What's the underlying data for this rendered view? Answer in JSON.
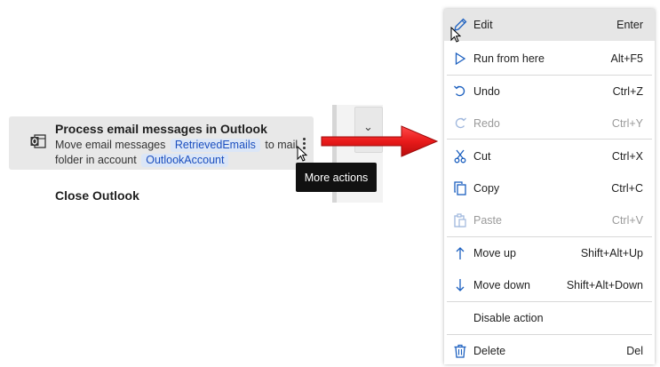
{
  "action_list": {
    "card": {
      "title": "Process email messages in Outlook",
      "desc_part1": "Move email messages",
      "token1": "RetrievedEmails",
      "desc_part2": "to mail folder  in account",
      "token2": "OutlookAccount"
    },
    "next_action_title": "Close Outlook",
    "more_actions_tooltip": "More actions"
  },
  "context_menu": {
    "items": [
      {
        "label": "Edit",
        "shortcut": "Enter",
        "icon": "pencil-icon"
      },
      {
        "label": "Run from here",
        "shortcut": "Alt+F5",
        "icon": "play-icon"
      },
      {
        "label": "Undo",
        "shortcut": "Ctrl+Z",
        "icon": "undo-icon"
      },
      {
        "label": "Redo",
        "shortcut": "Ctrl+Y",
        "icon": "redo-icon"
      },
      {
        "label": "Cut",
        "shortcut": "Ctrl+X",
        "icon": "scissors-icon"
      },
      {
        "label": "Copy",
        "shortcut": "Ctrl+C",
        "icon": "copy-icon"
      },
      {
        "label": "Paste",
        "shortcut": "Ctrl+V",
        "icon": "paste-icon"
      },
      {
        "label": "Move up",
        "shortcut": "Shift+Alt+Up",
        "icon": "arrow-up-icon"
      },
      {
        "label": "Move down",
        "shortcut": "Shift+Alt+Down",
        "icon": "arrow-down-icon"
      },
      {
        "label": "Disable action",
        "shortcut": "",
        "icon": ""
      },
      {
        "label": "Delete",
        "shortcut": "Del",
        "icon": "trash-icon"
      }
    ]
  },
  "colors": {
    "accent": "#1b5fbf",
    "arrow": "#e81a1a",
    "token_bg": "#dbe6f7"
  }
}
